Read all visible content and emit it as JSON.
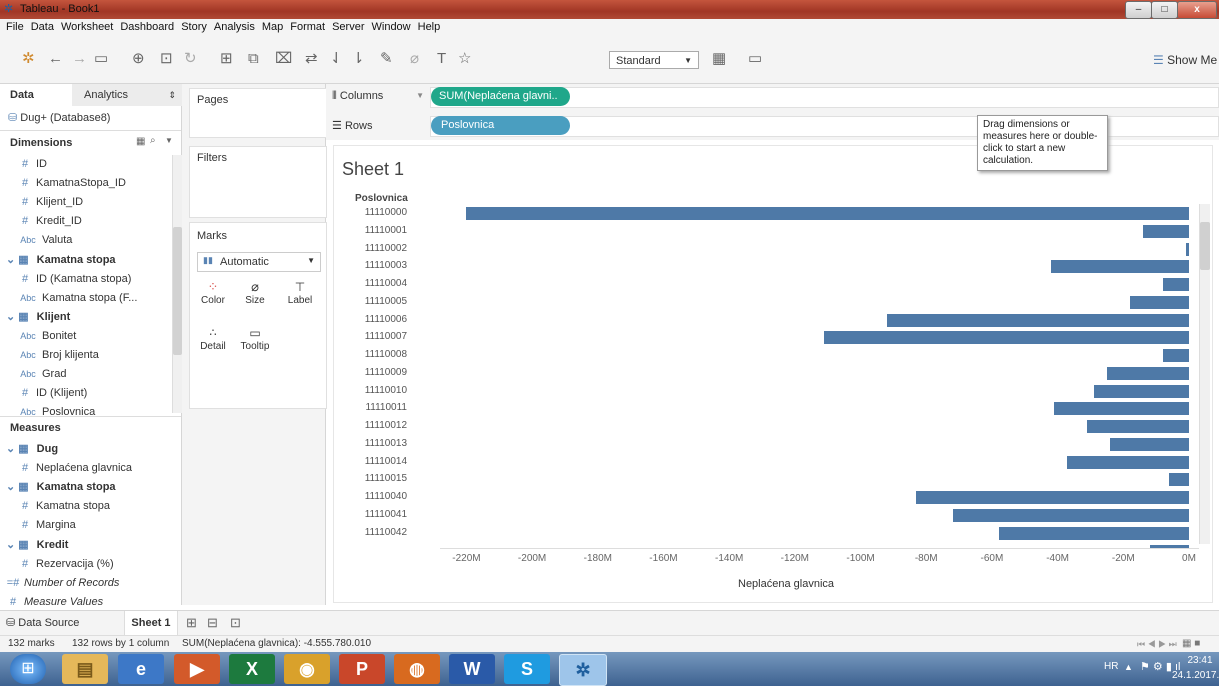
{
  "window": {
    "title": "Tableau - Book1",
    "minimize": "–",
    "maximize": "□",
    "close": "x"
  },
  "menu": [
    "File",
    "Data",
    "Worksheet",
    "Dashboard",
    "Story",
    "Analysis",
    "Map",
    "Format",
    "Server",
    "Window",
    "Help"
  ],
  "toolbar": {
    "fit_select": "Standard",
    "show_me": "Show Me"
  },
  "data_pane": {
    "tab_data": "Data",
    "tab_analytics": "Analytics",
    "datasource": "Dug+ (Database8)",
    "dimensions_header": "Dimensions",
    "dimensions": [
      {
        "kind": "num",
        "label": "ID",
        "indent": 1
      },
      {
        "kind": "num",
        "label": "KamatnaStopa_ID",
        "indent": 1
      },
      {
        "kind": "num",
        "label": "Klijent_ID",
        "indent": 1
      },
      {
        "kind": "num",
        "label": "Kredit_ID",
        "indent": 1
      },
      {
        "kind": "abc",
        "label": "Valuta",
        "indent": 1
      },
      {
        "kind": "table",
        "label": "Kamatna stopa",
        "indent": 0
      },
      {
        "kind": "num",
        "label": "ID (Kamatna stopa)",
        "indent": 1
      },
      {
        "kind": "abc",
        "label": "Kamatna stopa (F...",
        "indent": 1
      },
      {
        "kind": "table",
        "label": "Klijent",
        "indent": 0
      },
      {
        "kind": "abc",
        "label": "Bonitet",
        "indent": 1
      },
      {
        "kind": "abc",
        "label": "Broj klijenta",
        "indent": 1
      },
      {
        "kind": "abc",
        "label": "Grad",
        "indent": 1
      },
      {
        "kind": "num",
        "label": "ID (Klijent)",
        "indent": 1
      },
      {
        "kind": "abc",
        "label": "Poslovnica",
        "indent": 1
      }
    ],
    "measures_header": "Measures",
    "measures": [
      {
        "kind": "table",
        "label": "Dug",
        "indent": 0
      },
      {
        "kind": "num",
        "label": "Neplaćena glavnica",
        "indent": 1
      },
      {
        "kind": "table",
        "label": "Kamatna stopa",
        "indent": 0
      },
      {
        "kind": "num",
        "label": "Kamatna stopa",
        "indent": 1
      },
      {
        "kind": "num",
        "label": "Margina",
        "indent": 1
      },
      {
        "kind": "table",
        "label": "Kredit",
        "indent": 0
      },
      {
        "kind": "num",
        "label": "Rezervacija (%)",
        "indent": 1
      },
      {
        "kind": "calc",
        "label": "Number of Records",
        "indent": 0,
        "italic": true
      },
      {
        "kind": "num",
        "label": "Measure Values",
        "indent": 0,
        "italic": true
      }
    ]
  },
  "cards": {
    "pages": "Pages",
    "filters": "Filters",
    "marks": "Marks",
    "mark_type": "Automatic",
    "mark_buttons": [
      "Color",
      "Size",
      "Label",
      "Detail",
      "Tooltip"
    ]
  },
  "shelves": {
    "columns_label": "Columns",
    "columns_pill": "SUM(Neplaćena glavni..",
    "rows_label": "Rows",
    "rows_pill": "Poslovnica"
  },
  "tooltip": "Drag dimensions or measures here or double-click to start a new calculation.",
  "sheet_title": "Sheet 1",
  "colors": {
    "bar": "#4e79a7",
    "pill_green": "#1fa78a",
    "pill_blue": "#4a9ec0"
  },
  "chart_data": {
    "type": "bar",
    "orientation": "horizontal",
    "row_header": "Poslovnica",
    "xlabel": "Neplaćena glavnica",
    "xlim": [
      -225,
      0
    ],
    "x_unit": "M",
    "x_ticks": [
      "-220M",
      "-200M",
      "-180M",
      "-160M",
      "-140M",
      "-120M",
      "-100M",
      "-80M",
      "-60M",
      "-40M",
      "-20M",
      "0M"
    ],
    "categories": [
      "11110000",
      "11110001",
      "11110002",
      "11110003",
      "11110004",
      "11110005",
      "11110006",
      "11110007",
      "11110008",
      "11110009",
      "11110010",
      "11110011",
      "11110012",
      "11110013",
      "11110014",
      "11110015",
      "11110040",
      "11110041",
      "11110042"
    ],
    "values": [
      -220,
      -14,
      -1,
      -42,
      -8,
      -18,
      -92,
      -111,
      -8,
      -25,
      -29,
      -41,
      -31,
      -24,
      -37,
      -6,
      -83,
      -72,
      -58
    ]
  },
  "sheet_tabs": {
    "data_source": "Data Source",
    "sheet": "Sheet 1"
  },
  "status": {
    "marks": "132 marks",
    "rows": "132 rows by 1 column",
    "sum": "SUM(Neplaćena glavnica): -4.555.780.010"
  },
  "taskbar": {
    "lang": "HR",
    "time": "23:41",
    "date": "24.1.2017."
  }
}
